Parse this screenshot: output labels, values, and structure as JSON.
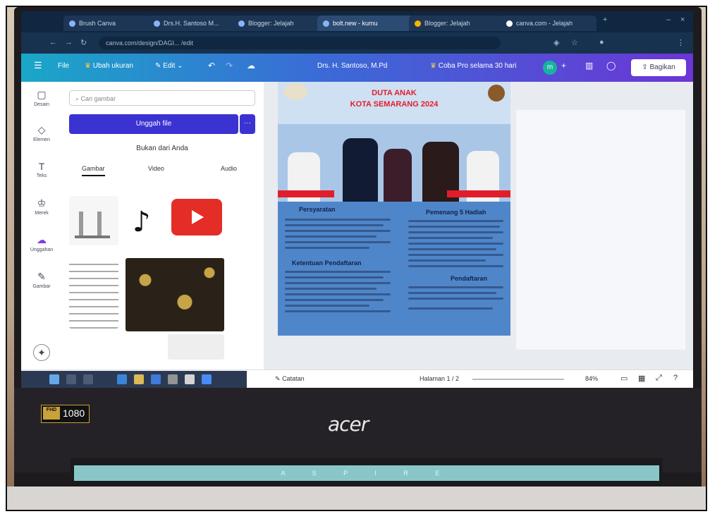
{
  "browser": {
    "tabs": [
      {
        "label": "Brush Canva"
      },
      {
        "label": "Drs.H. Santoso M..."
      },
      {
        "label": "Blogger: Jelajah"
      },
      {
        "label": "bolt.new - kumu"
      },
      {
        "label": "Blogger: Jelajah"
      },
      {
        "label": "canva.com - Jelajah"
      }
    ],
    "url": "canva.com/design/DAGI... /edit"
  },
  "toolbar": {
    "menu_icon": "menu-icon",
    "file_label": "File",
    "resize_label": "Ubah ukuran",
    "edit_label": "Edit",
    "doc_title": "Drs. H. Santoso, M.Pd",
    "pro_label": "Coba Pro selama 30 hari",
    "avatar_initial": "m",
    "share_label": "Bagikan"
  },
  "rail": {
    "items": [
      {
        "label": "Desain",
        "icon": "design-icon"
      },
      {
        "label": "Elemen",
        "icon": "elements-icon"
      },
      {
        "label": "Teks",
        "icon": "text-icon"
      },
      {
        "label": "Merek",
        "icon": "brand-icon"
      },
      {
        "label": "Unggahan",
        "icon": "upload-icon"
      },
      {
        "label": "Gambar",
        "icon": "draw-icon"
      }
    ]
  },
  "panel": {
    "search_placeholder": "Cari gambar",
    "upload_label": "Unggah file",
    "upload_more": "···",
    "secondary_label": "Bukan dari Anda",
    "tabs": [
      "Gambar",
      "Video",
      "Audio"
    ]
  },
  "poster": {
    "title_line1": "DUTA ANAK",
    "title_line2": "KOTA SEMARANG 2024",
    "heading_left": "Persyaratan",
    "heading_right": "Pemenang 5 Hadiah",
    "heading_left2": "Ketentuan Pendaftaran",
    "heading_right2": "Pendaftaran"
  },
  "canvas_footer": {
    "notes_label": "Catatan",
    "page_label": "Halaman 1 / 2",
    "zoom": "84%"
  },
  "laptop": {
    "resolution_badge": "1080",
    "hd_badge": "FHD",
    "brand": "acer",
    "strip": "A S P I R E"
  }
}
